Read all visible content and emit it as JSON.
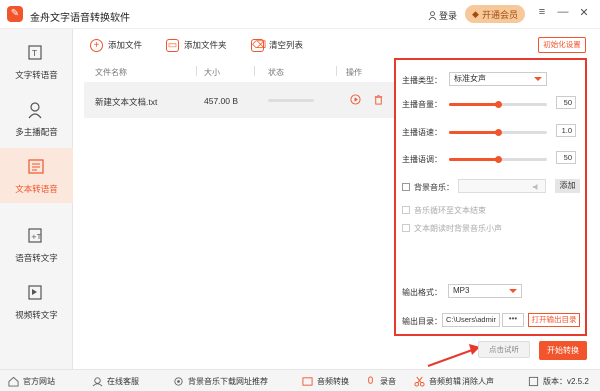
{
  "app": {
    "title": "金舟文字语音转换软件",
    "login": "登录",
    "vip": "开通会员"
  },
  "sidebar": {
    "items": [
      {
        "label": "文字转语音"
      },
      {
        "label": "多主播配音"
      },
      {
        "label": "文本转语音"
      },
      {
        "label": "语音转文字"
      },
      {
        "label": "视频转文字"
      }
    ]
  },
  "toolbar": {
    "add_file": "添加文件",
    "add_folder": "添加文件夹",
    "clear_list": "清空列表",
    "reset_settings": "初始化设置"
  },
  "file_list": {
    "headers": [
      "文件名称",
      "大小",
      "状态",
      "操作"
    ],
    "rows": [
      {
        "name": "新建文本文档.txt",
        "size": "457.00 B"
      }
    ]
  },
  "settings": {
    "voice_type_label": "主播类型：",
    "voice_type_value": "标准女声",
    "volume_label": "主播音量：",
    "volume_value": "50",
    "volume_fraction": 0.5,
    "speed_label": "主播语速：",
    "speed_value": "1.0",
    "speed_fraction": 0.5,
    "pitch_label": "主播语调：",
    "pitch_value": "50",
    "pitch_fraction": 0.5,
    "bg_music_label": "背景音乐：",
    "bg_add": "添加",
    "loop_label": "音乐循环至文本结束",
    "lower_label": "文本朗读时背景音乐小声",
    "format_label": "输出格式：",
    "format_value": "MP3",
    "dir_label": "输出目录：",
    "dir_value": "C:\\Users\\admir",
    "dir_dots": "•••",
    "open_dir": "打开输出目录"
  },
  "actions": {
    "preview": "点击试听",
    "start": "开始转换"
  },
  "footer": {
    "site": "官方网站",
    "support": "在线客服",
    "bgm": "背景音乐下载网址推荐",
    "audio_convert": "音频转换",
    "record": "录音",
    "audio_edit": "音频剪辑",
    "remove_voice": "消除人声",
    "version": "版本：v2.5.2"
  },
  "colors": {
    "accent": "#f2552c",
    "highlight_border": "#e63a2e"
  }
}
